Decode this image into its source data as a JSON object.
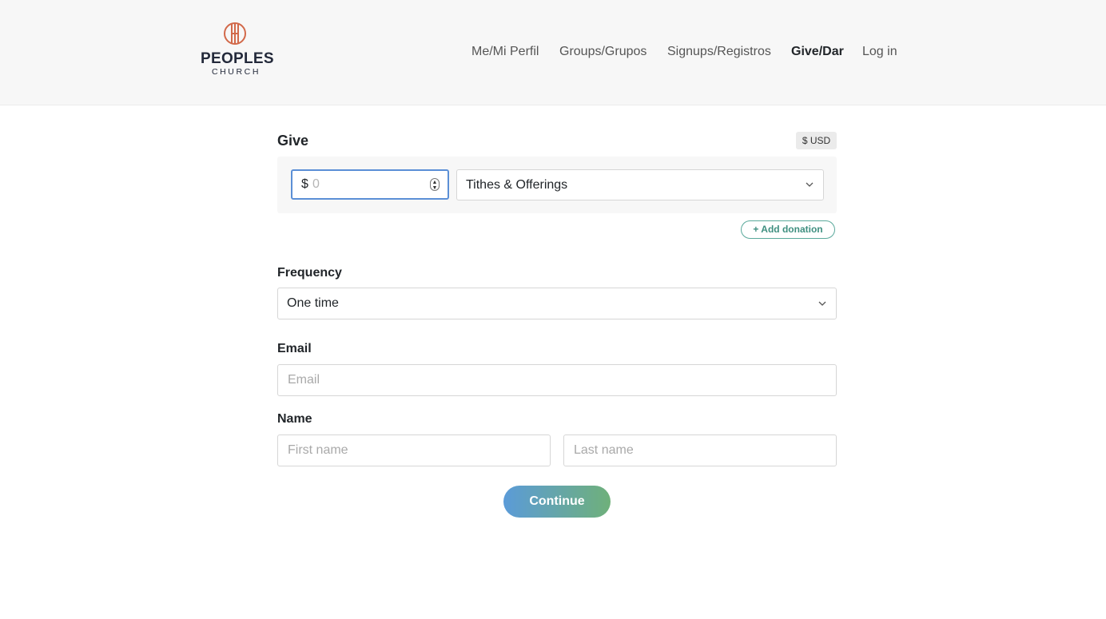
{
  "header": {
    "logo": {
      "name": "PEOPLES",
      "sub": "CHURCH",
      "accent": "#d2694a"
    },
    "nav": [
      {
        "label": "Me/Mi Perfil",
        "active": false
      },
      {
        "label": "Groups/Grupos",
        "active": false
      },
      {
        "label": "Signups/Registros",
        "active": false
      },
      {
        "label": "Give/Dar",
        "active": true
      },
      {
        "label": "Log in",
        "active": false
      }
    ]
  },
  "give": {
    "title": "Give",
    "currency": "$ USD",
    "amount_prefix": "$",
    "amount_placeholder": "0",
    "fund_selected": "Tithes & Offerings",
    "add_donation_label": "+ Add donation"
  },
  "frequency": {
    "label": "Frequency",
    "selected": "One time"
  },
  "email": {
    "label": "Email",
    "placeholder": "Email"
  },
  "name": {
    "label": "Name",
    "first_placeholder": "First name",
    "last_placeholder": "Last name"
  },
  "continue_label": "Continue",
  "colors": {
    "focus_border": "#5b8fd6",
    "add_donation": "#3f8f80",
    "button_gradient_start": "#5b9bd8",
    "button_gradient_end": "#6fb07a"
  }
}
